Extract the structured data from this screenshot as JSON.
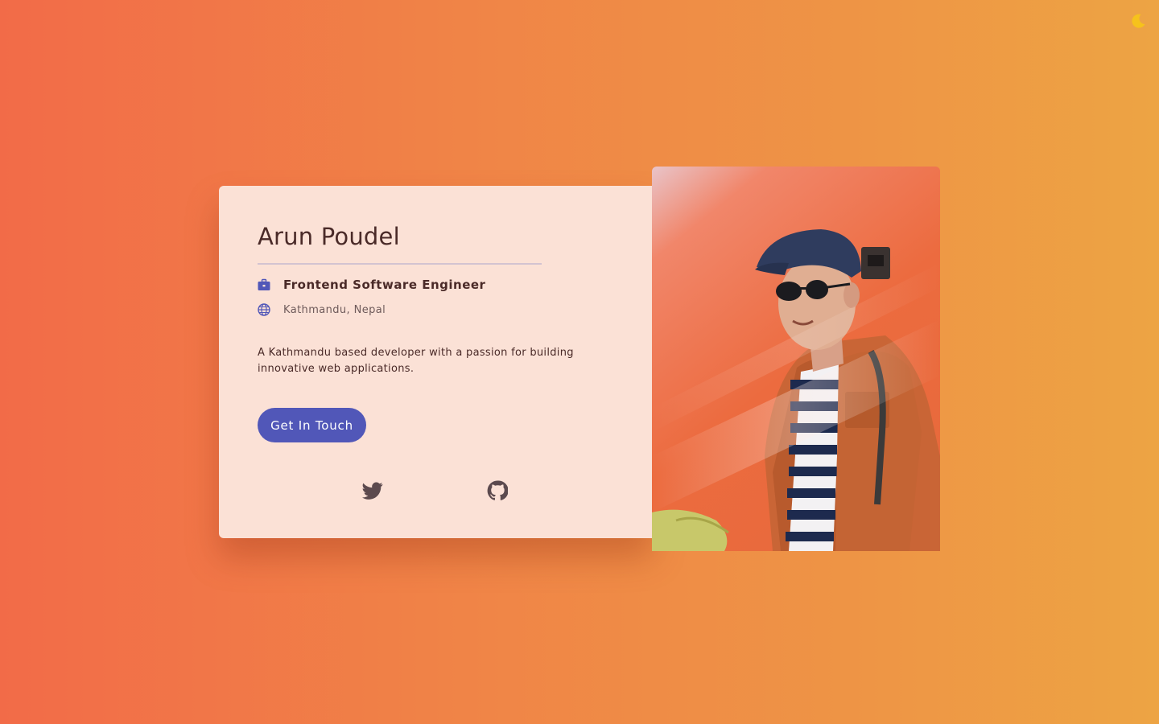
{
  "theme_toggle": {
    "icon": "crescent-moon-icon"
  },
  "profile": {
    "name": "Arun Poudel",
    "job_title": "Frontend Software Engineer",
    "location": "Kathmandu, Nepal",
    "bio": "A Kathmandu based developer with a passion for building innovative web applications.",
    "cta_label": "Get In Touch"
  },
  "icons": {
    "job": "briefcase-icon",
    "location": "globe-icon"
  },
  "social": [
    {
      "name": "twitter",
      "icon": "twitter-icon"
    },
    {
      "name": "github",
      "icon": "github-icon"
    }
  ],
  "photo": {
    "alt": "Arun Poudel"
  },
  "colors": {
    "background_start": "#f26b48",
    "background_end": "#eda444",
    "card": "#fbe1d6",
    "accent": "#5157b8",
    "text": "#4a2a28"
  }
}
